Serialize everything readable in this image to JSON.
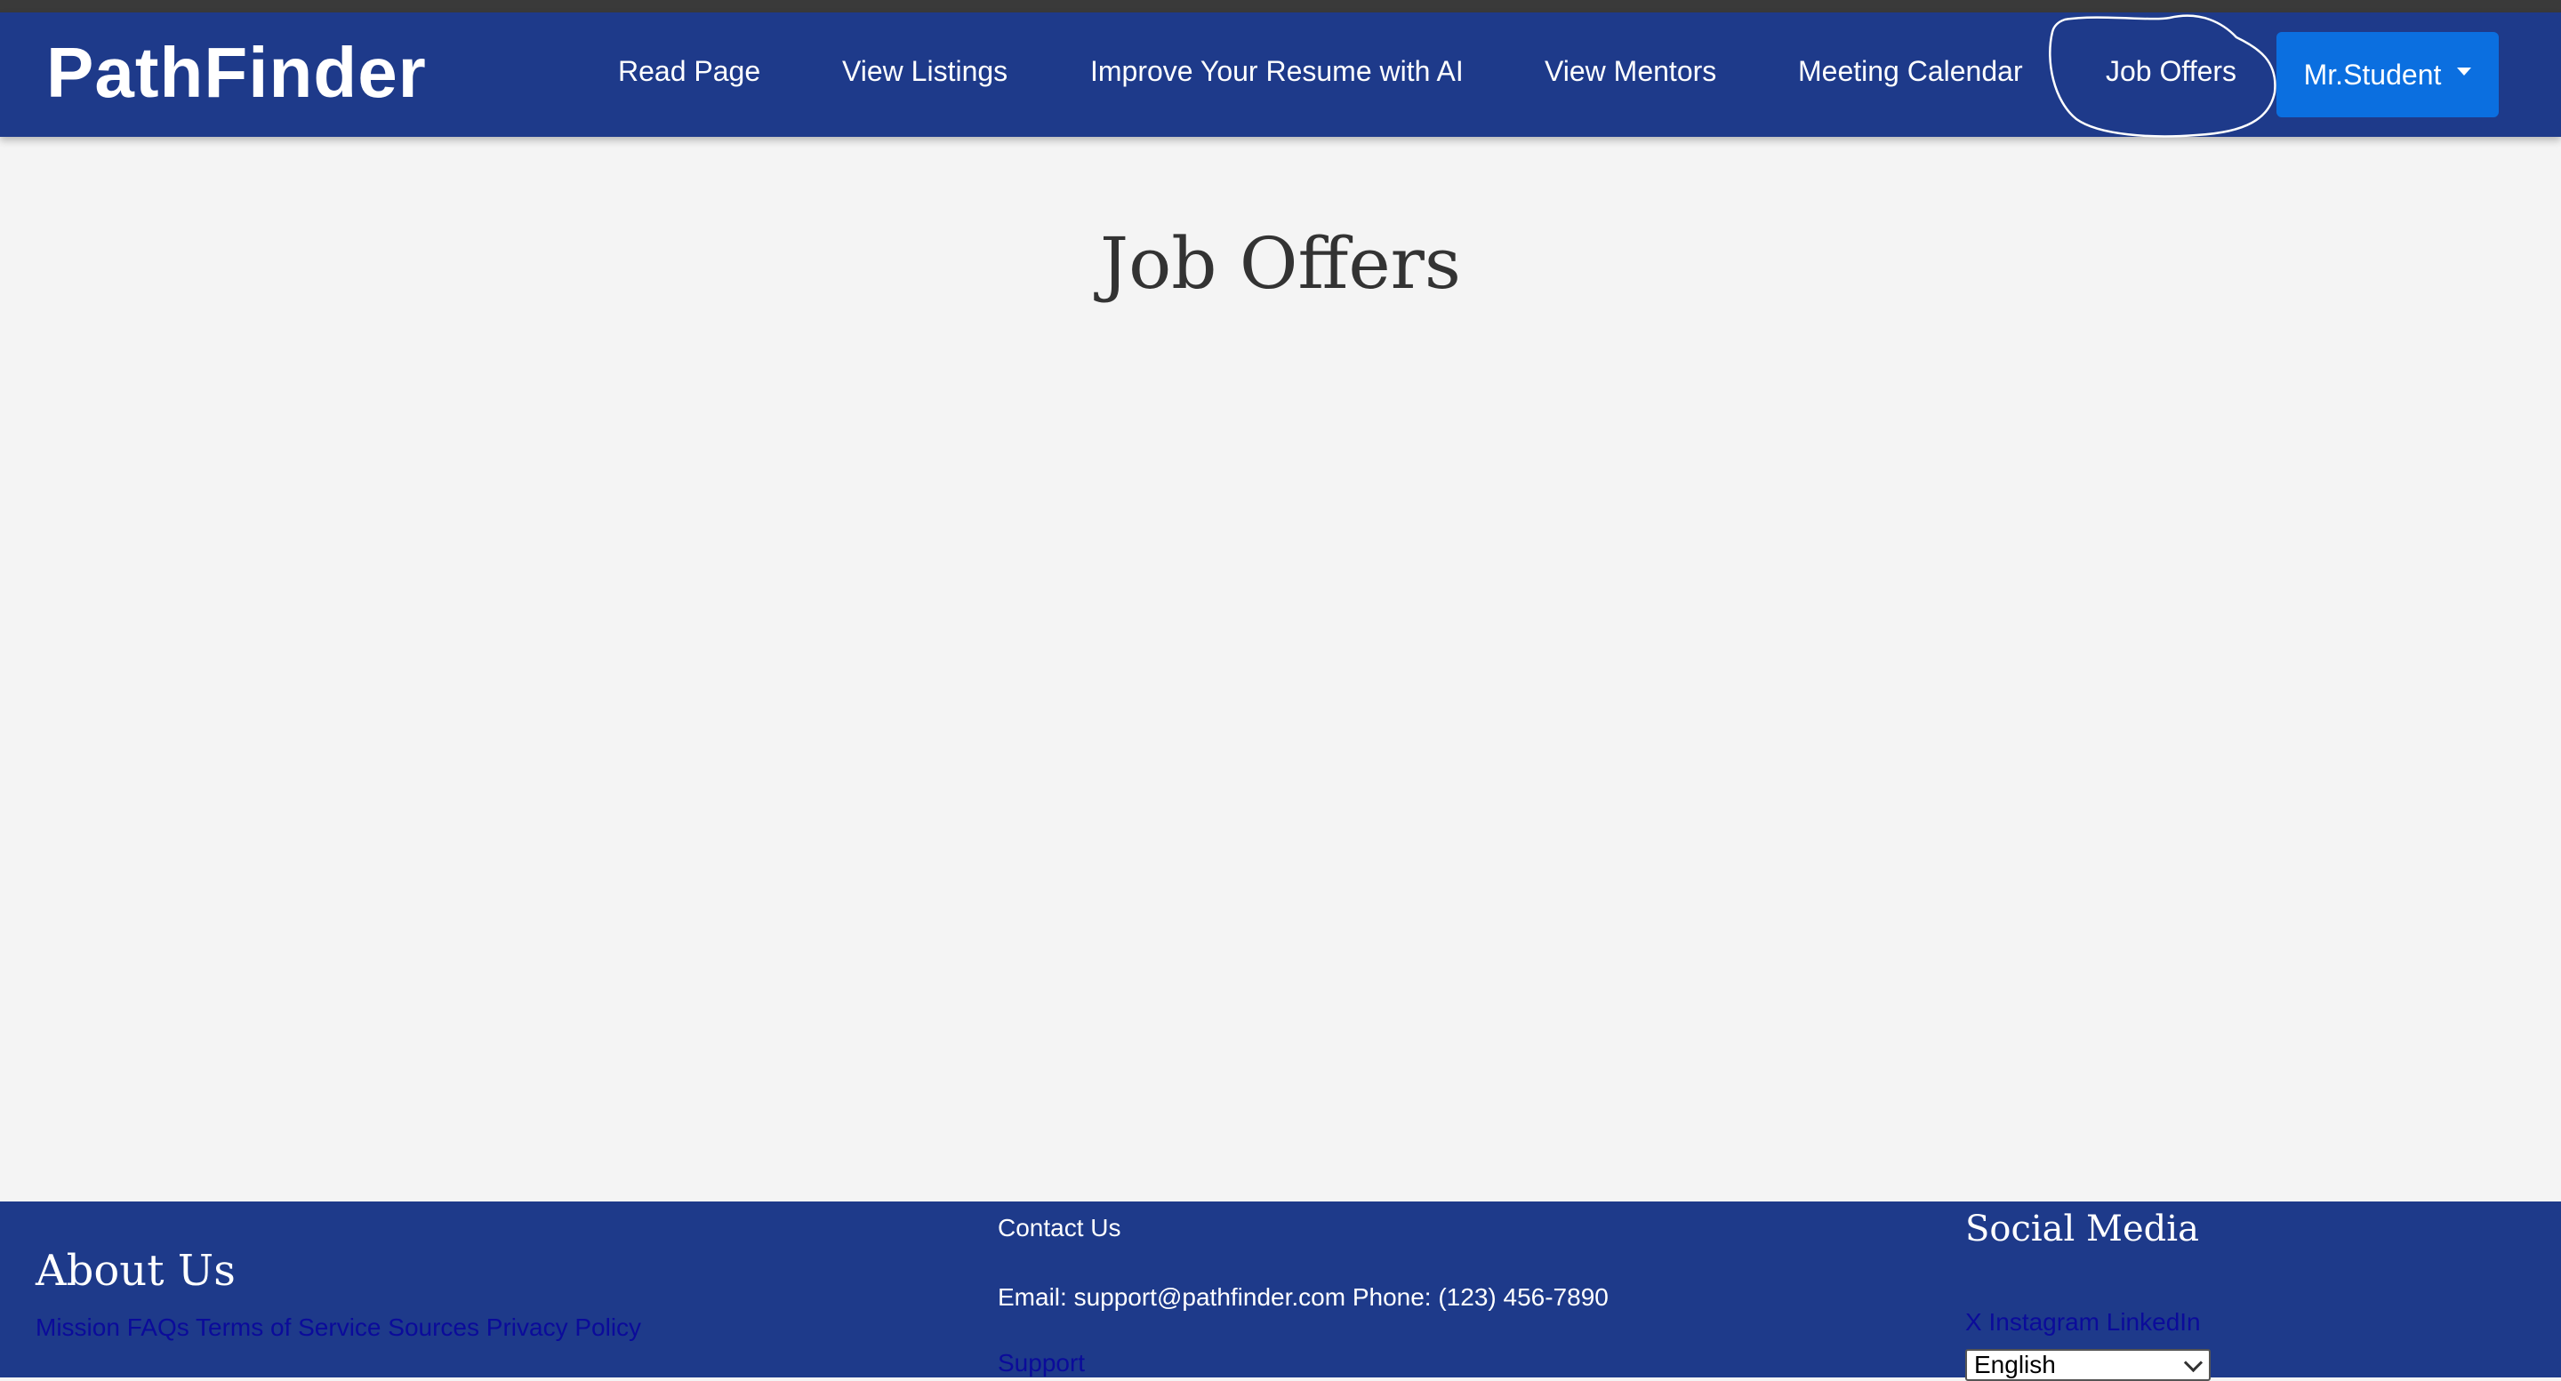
{
  "app": {
    "brand": "PathFinder"
  },
  "nav": {
    "items": [
      {
        "label": "Read Page"
      },
      {
        "label": "View Listings"
      },
      {
        "label": "Improve Your Resume with AI"
      },
      {
        "label": "View Mentors"
      },
      {
        "label": "Meeting Calendar"
      },
      {
        "label": "Job Offers",
        "active": true
      }
    ],
    "user_menu": "Mr.Student"
  },
  "main": {
    "title": "Job Offers"
  },
  "footer": {
    "about": {
      "title": "About Us",
      "links": [
        "Mission",
        "FAQs",
        "Terms of Service",
        "Sources",
        "Privacy Policy"
      ]
    },
    "contact": {
      "title": "Contact Us",
      "info": "Email: support@pathfinder.com Phone: (123) 456-7890",
      "support_link": "Support"
    },
    "social": {
      "title": "Social Media",
      "links": [
        "X",
        "Instagram",
        "LinkedIn"
      ]
    },
    "language": {
      "selected": "English"
    }
  },
  "colors": {
    "navbar": "#1e3a8a",
    "user_button": "#0b6fe0",
    "background": "#f4f4f4",
    "footer_link": "#0b0b9a"
  }
}
